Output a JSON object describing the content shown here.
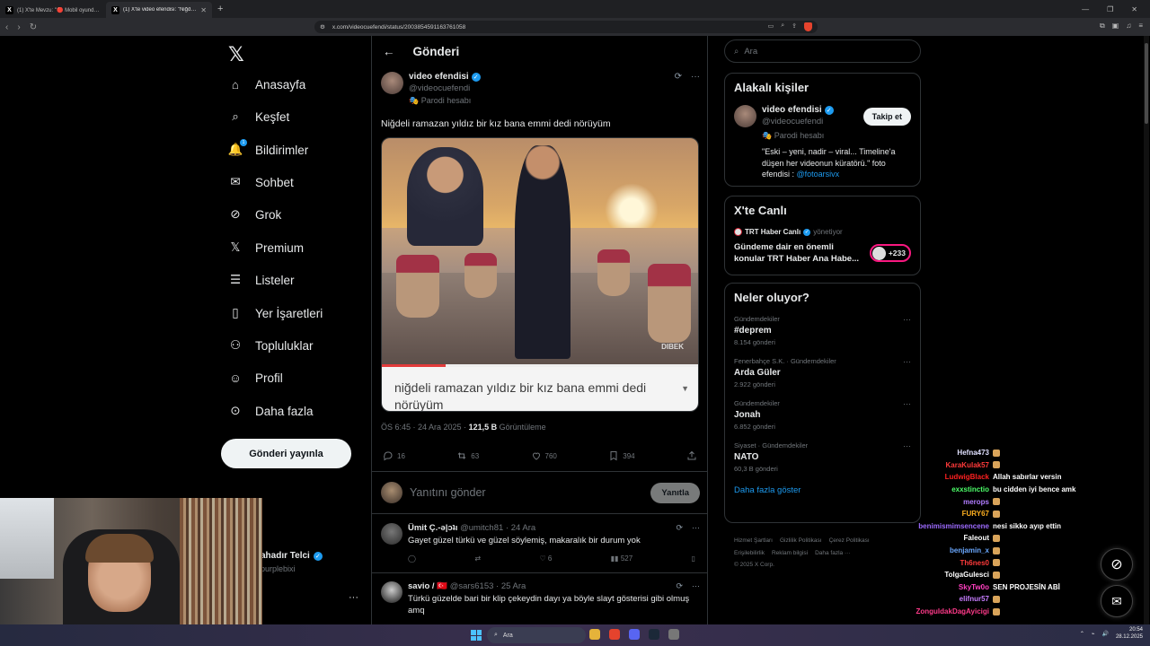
{
  "browser": {
    "tabs": [
      {
        "title": "(1) X'te Mevzu: \"🔴 Mobil oyunda R...",
        "active": false
      },
      {
        "title": "(1) X'te video efendisi: \"Niğdeli r...",
        "active": true
      }
    ],
    "url": "x.com/videocuefendi/status/2003854591163761058"
  },
  "nav": {
    "items": [
      {
        "label": "Anasayfa",
        "icon": "home-icon"
      },
      {
        "label": "Keşfet",
        "icon": "search-icon"
      },
      {
        "label": "Bildirimler",
        "icon": "bell-icon",
        "badge": "1"
      },
      {
        "label": "Sohbet",
        "icon": "mail-icon"
      },
      {
        "label": "Grok",
        "icon": "grok-icon"
      },
      {
        "label": "Premium",
        "icon": "x-icon"
      },
      {
        "label": "Listeler",
        "icon": "list-icon"
      },
      {
        "label": "Yer İşaretleri",
        "icon": "bookmark-icon"
      },
      {
        "label": "Topluluklar",
        "icon": "people-icon"
      },
      {
        "label": "Profil",
        "icon": "user-icon"
      },
      {
        "label": "Daha fazla",
        "icon": "more-circle-icon"
      }
    ],
    "post_button": "Gönderi yayınla",
    "profile": {
      "name": "ahadır Telci",
      "handle": "purplebixi"
    }
  },
  "post": {
    "header": "Gönderi",
    "author": {
      "name": "video efendisi",
      "handle": "@videocuefendi",
      "label": "Parodi hesabı"
    },
    "text": "Niğdeli ramazan yıldız bir kız bana emmi dedi nörüyüm",
    "media": {
      "watermark": "DIBEK",
      "caption": "niğdeli ramazan yıldız bir kız bana emmi dedi nörüyüm",
      "progress": 0.2
    },
    "time": "ÖS 6:45 · 24 Ara 2025 · ",
    "views_count": "121,5 B",
    "views_label": " Görüntüleme",
    "stats": {
      "replies": "16",
      "reposts": "63",
      "likes": "760",
      "bookmarks": "394"
    },
    "reply_placeholder": "Yanıtını gönder",
    "reply_button": "Yanıtla"
  },
  "replies": [
    {
      "name": "Ümit Ç.-ǝ|ɔʇı",
      "meta": "@umitch81 · 24 Ara",
      "text": "Gayet güzel türkü ve güzel söylemiş, makaralık bir durum yok",
      "stats": {
        "replies": "",
        "reposts": "",
        "likes": "6",
        "views": "527"
      }
    },
    {
      "name": "savio / 🇹🇷",
      "meta": "@sars6153 · 25 Ara",
      "text": "Türkü güzelde bari bir klip çekeydin dayı ya böyle slayt gösterisi gibi olmuş amq"
    }
  ],
  "sidebar": {
    "search_placeholder": "Ara",
    "related": {
      "title": "Alakalı kişiler",
      "name": "video efendisi",
      "handle": "@videocuefendi",
      "label": "Parodi hesabı",
      "bio": "\"Eski – yeni, nadir – viral... Timeline'a düşen her videonun küratörü.\" foto efendisi : ",
      "bio_link": "@fotoarsivx",
      "follow": "Takip et"
    },
    "live": {
      "title": "X'te Canlı",
      "host": "TRT Haber Canlı",
      "host_role": "yönetiyor",
      "text": "Gündeme dair en önemli konular TRT Haber Ana Habe...",
      "count": "+233"
    },
    "trends": {
      "title": "Neler oluyor?",
      "items": [
        {
          "context": "Gündemdekiler",
          "name": "#deprem",
          "count": "8.154 gönderi"
        },
        {
          "context": "Fenerbahçe S.K. · Gündemdekiler",
          "name": "Arda Güler",
          "count": "2.922 gönderi"
        },
        {
          "context": "Gündemdekiler",
          "name": "Jonah",
          "count": "6.852 gönderi"
        },
        {
          "context": "Siyaset · Gündemdekiler",
          "name": "NATO",
          "count": "60,3 B gönderi"
        }
      ],
      "show_more": "Daha fazla göster"
    },
    "footer": [
      "Hizmet Şartları",
      "Gizlilik Politikası",
      "Çerez Politikası",
      "Erişilebilirlik",
      "Reklam bilgisi",
      "Daha fazla ···",
      "© 2025 X Corp."
    ]
  },
  "chat": [
    {
      "user": "Hefna473",
      "color": "#e0e0ff",
      "msg": ""
    },
    {
      "user": "KaraKulak57",
      "color": "#ff3a3a",
      "msg": ""
    },
    {
      "user": "LudwigBlack",
      "color": "#ff2020",
      "msg": "Allah sabırlar versin"
    },
    {
      "user": "exxstinctio",
      "color": "#4dff6a",
      "msg": "bu cidden iyi bence amk"
    },
    {
      "user": "merops",
      "color": "#b07cff",
      "msg": ""
    },
    {
      "user": "FURY67",
      "color": "#ffb020",
      "msg": ""
    },
    {
      "user": "benimismimsencene",
      "color": "#9d6bff",
      "msg": "nesi sikko ayıp ettin"
    },
    {
      "user": "Faleout",
      "color": "#ffffff",
      "msg": ""
    },
    {
      "user": "benjamin_x",
      "color": "#6aa8ff",
      "msg": ""
    },
    {
      "user": "Th6nes0",
      "color": "#ff3a3a",
      "msg": ""
    },
    {
      "user": "TolgaGulesci",
      "color": "#ffffff",
      "msg": ""
    },
    {
      "user": "SkyTw0o",
      "color": "#ff40c0",
      "msg": "SEN PROJESİN ABİ"
    },
    {
      "user": "elifnur57",
      "color": "#c77dff",
      "msg": ""
    },
    {
      "user": "ZonguldakDagAyicigi",
      "color": "#ff3a8a",
      "msg": ""
    }
  ],
  "taskbar": {
    "search": "Ara",
    "time": "20:54",
    "date": "28.12.2025"
  }
}
